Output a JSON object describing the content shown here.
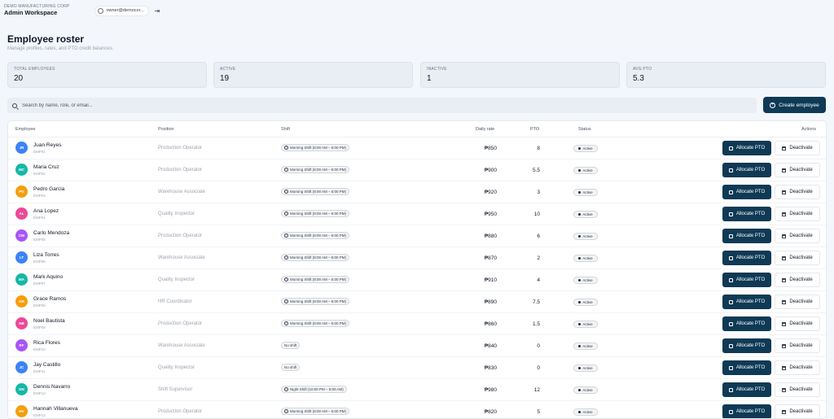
{
  "topbar": {
    "org_name": "DEMO MANUFACTURING CORP",
    "workspace": "Admin Workspace",
    "account_email": "owner@democor...",
    "account_icon": "user-circle-icon",
    "logout_icon": "logout-icon"
  },
  "page": {
    "title": "Employee roster",
    "subtitle": "Manage profiles, rates, and PTO credit balances."
  },
  "stats": [
    {
      "label": "TOTAL EMPLOYEES",
      "value": "20"
    },
    {
      "label": "ACTIVE",
      "value": "19"
    },
    {
      "label": "INACTIVE",
      "value": "1"
    },
    {
      "label": "AVG PTO",
      "value": "5.3"
    }
  ],
  "search": {
    "placeholder": "Search by name, role, or email...",
    "value": ""
  },
  "create_button": {
    "label": "Create employee"
  },
  "table": {
    "headers": {
      "employee": "Employee",
      "position": "Position",
      "shift": "Shift",
      "daily_rate": "Daily rate",
      "pto": "PTO",
      "status": "Status",
      "actions": "Actions"
    },
    "rows": [
      {
        "initials": "JR",
        "color": "#3b82f6",
        "name": "Juan Reyes",
        "code": "EMP01",
        "position": "Production Operator",
        "shift": "Morning Shift (8:00 AM – 5:00 PM)",
        "rate": "₱850",
        "pto": "8",
        "status": "Active",
        "alloc": "Allocate PTO",
        "deact": "Deactivate"
      },
      {
        "initials": "MC",
        "color": "#14b8a6",
        "name": "Maria Cruz",
        "code": "EMP02",
        "position": "Production Operator",
        "shift": "Morning Shift (8:00 AM – 5:00 PM)",
        "rate": "₱900",
        "pto": "5.5",
        "status": "Active",
        "alloc": "Allocate PTO",
        "deact": "Deactivate"
      },
      {
        "initials": "PG",
        "color": "#f59e0b",
        "name": "Pedro Garcia",
        "code": "EMP03",
        "position": "Warehouse Associate",
        "shift": "Morning Shift (8:00 AM – 5:00 PM)",
        "rate": "₱920",
        "pto": "3",
        "status": "Active",
        "alloc": "Allocate PTO",
        "deact": "Deactivate"
      },
      {
        "initials": "AL",
        "color": "#ec4899",
        "name": "Ana Lopez",
        "code": "EMP04",
        "position": "Quality Inspector",
        "shift": "Morning Shift (8:00 AM – 5:00 PM)",
        "rate": "₱950",
        "pto": "10",
        "status": "Active",
        "alloc": "Allocate PTO",
        "deact": "Deactivate"
      },
      {
        "initials": "CM",
        "color": "#a855f7",
        "name": "Carlo Mendoza",
        "code": "EMP05",
        "position": "Production Operator",
        "shift": "Morning Shift (8:00 AM – 5:00 PM)",
        "rate": "₱880",
        "pto": "6",
        "status": "Active",
        "alloc": "Allocate PTO",
        "deact": "Deactivate"
      },
      {
        "initials": "LT",
        "color": "#3b82f6",
        "name": "Liza Torres",
        "code": "EMP06",
        "position": "Warehouse Associate",
        "shift": "Morning Shift (8:00 AM – 5:00 PM)",
        "rate": "₱870",
        "pto": "2",
        "status": "Active",
        "alloc": "Allocate PTO",
        "deact": "Deactivate"
      },
      {
        "initials": "MA",
        "color": "#14b8a6",
        "name": "Mark Aquino",
        "code": "EMP07",
        "position": "Quality Inspector",
        "shift": "Morning Shift (8:00 AM – 5:00 PM)",
        "rate": "₱910",
        "pto": "4",
        "status": "Active",
        "alloc": "Allocate PTO",
        "deact": "Deactivate"
      },
      {
        "initials": "GR",
        "color": "#f59e0b",
        "name": "Grace Ramos",
        "code": "EMP08",
        "position": "HR Coordinator",
        "shift": "Morning Shift (8:00 AM – 5:00 PM)",
        "rate": "₱890",
        "pto": "7.5",
        "status": "Active",
        "alloc": "Allocate PTO",
        "deact": "Deactivate"
      },
      {
        "initials": "NB",
        "color": "#ec4899",
        "name": "Noel Bautista",
        "code": "EMP09",
        "position": "Production Operator",
        "shift": "Morning Shift (8:00 AM – 5:00 PM)",
        "rate": "₱860",
        "pto": "1.5",
        "status": "Active",
        "alloc": "Allocate PTO",
        "deact": "Deactivate"
      },
      {
        "initials": "RF",
        "color": "#a855f7",
        "name": "Rica Flores",
        "code": "EMP10",
        "position": "Warehouse Associate",
        "shift": "No shift",
        "rate": "₱840",
        "pto": "0",
        "status": "Active",
        "alloc": "Allocate PTO",
        "deact": "Deactivate"
      },
      {
        "initials": "JC",
        "color": "#3b82f6",
        "name": "Jay Castillo",
        "code": "EMP11",
        "position": "Quality Inspector",
        "shift": "No shift",
        "rate": "₱830",
        "pto": "0",
        "status": "Active",
        "alloc": "Allocate PTO",
        "deact": "Deactivate"
      },
      {
        "initials": "DN",
        "color": "#14b8a6",
        "name": "Dennis Navarro",
        "code": "EMP12",
        "position": "Shift Supervisor",
        "shift": "Night Shift (10:00 PM – 6:00 AM)",
        "rate": "₱980",
        "pto": "12",
        "status": "Active",
        "alloc": "Allocate PTO",
        "deact": "Deactivate"
      },
      {
        "initials": "HV",
        "color": "#f59e0b",
        "name": "Hannah Villanueva",
        "code": "EMP13",
        "position": "Production Operator",
        "shift": "Morning Shift (8:00 AM – 5:00 PM)",
        "rate": "₱820",
        "pto": "5",
        "status": "Active",
        "alloc": "Allocate PTO",
        "deact": "Deactivate"
      }
    ]
  }
}
